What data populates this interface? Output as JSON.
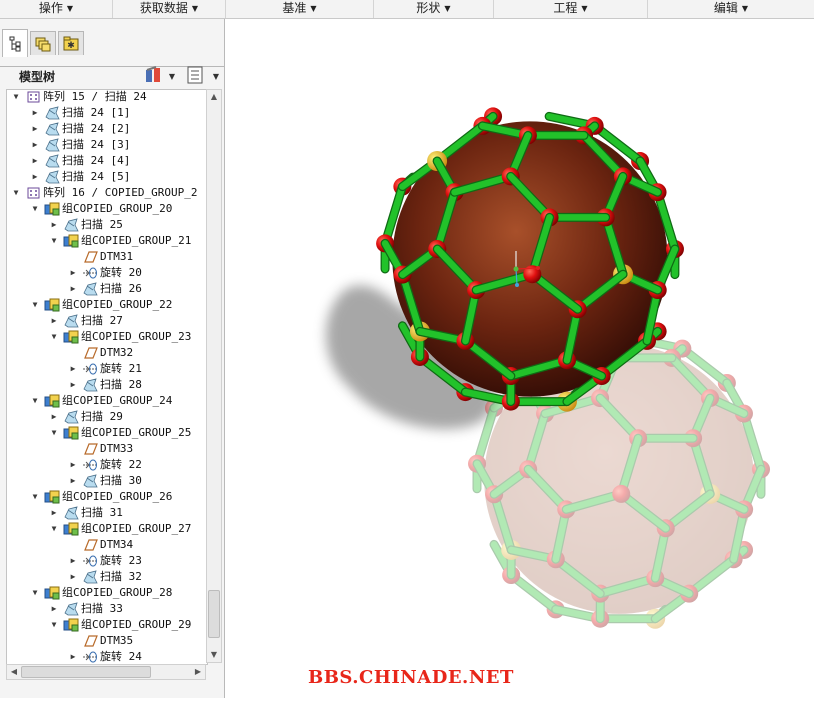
{
  "menu": [
    {
      "label": "操作"
    },
    {
      "label": "获取数据"
    },
    {
      "label": "基准"
    },
    {
      "label": "形状"
    },
    {
      "label": "工程"
    },
    {
      "label": "编辑"
    }
  ],
  "panel": {
    "tabs": [
      "model-tree-tab-icon",
      "layer-tab-icon",
      "favorites-tab-icon"
    ],
    "tree_title": "模型树",
    "settings_icon": "tree-settings-icon",
    "columns_icon": "tree-columns-icon"
  },
  "tree": [
    {
      "level": 0,
      "exp": "open",
      "icon": "pattern",
      "label": "阵列 15 / 扫描 24"
    },
    {
      "level": 1,
      "exp": "closed",
      "icon": "sweep",
      "label": "扫描 24 [1]"
    },
    {
      "level": 1,
      "exp": "closed",
      "icon": "sweep",
      "label": "扫描 24 [2]"
    },
    {
      "level": 1,
      "exp": "closed",
      "icon": "sweep",
      "label": "扫描 24 [3]"
    },
    {
      "level": 1,
      "exp": "closed",
      "icon": "sweep",
      "label": "扫描 24 [4]"
    },
    {
      "level": 1,
      "exp": "closed",
      "icon": "sweep",
      "label": "扫描 24 [5]"
    },
    {
      "level": 0,
      "exp": "open",
      "icon": "pattern",
      "label": "阵列 16 / COPIED_GROUP_2"
    },
    {
      "level": 1,
      "exp": "open",
      "icon": "group",
      "label": "组COPIED_GROUP_20"
    },
    {
      "level": 2,
      "exp": "closed",
      "icon": "sweep",
      "label": "扫描 25"
    },
    {
      "level": 2,
      "exp": "open",
      "icon": "group",
      "label": "组COPIED_GROUP_21"
    },
    {
      "level": 3,
      "exp": "none",
      "icon": "datum",
      "label": "DTM31"
    },
    {
      "level": 3,
      "exp": "closed",
      "icon": "revolve",
      "label": "旋转 20"
    },
    {
      "level": 3,
      "exp": "closed",
      "icon": "sweep",
      "label": "扫描 26"
    },
    {
      "level": 1,
      "exp": "open",
      "icon": "group",
      "label": "组COPIED_GROUP_22"
    },
    {
      "level": 2,
      "exp": "closed",
      "icon": "sweep",
      "label": "扫描 27"
    },
    {
      "level": 2,
      "exp": "open",
      "icon": "group",
      "label": "组COPIED_GROUP_23"
    },
    {
      "level": 3,
      "exp": "none",
      "icon": "datum",
      "label": "DTM32"
    },
    {
      "level": 3,
      "exp": "closed",
      "icon": "revolve",
      "label": "旋转 21"
    },
    {
      "level": 3,
      "exp": "closed",
      "icon": "sweep",
      "label": "扫描 28"
    },
    {
      "level": 1,
      "exp": "open",
      "icon": "group",
      "label": "组COPIED_GROUP_24"
    },
    {
      "level": 2,
      "exp": "closed",
      "icon": "sweep",
      "label": "扫描 29"
    },
    {
      "level": 2,
      "exp": "open",
      "icon": "group",
      "label": "组COPIED_GROUP_25"
    },
    {
      "level": 3,
      "exp": "none",
      "icon": "datum",
      "label": "DTM33"
    },
    {
      "level": 3,
      "exp": "closed",
      "icon": "revolve",
      "label": "旋转 22"
    },
    {
      "level": 3,
      "exp": "closed",
      "icon": "sweep",
      "label": "扫描 30"
    },
    {
      "level": 1,
      "exp": "open",
      "icon": "group",
      "label": "组COPIED_GROUP_26"
    },
    {
      "level": 2,
      "exp": "closed",
      "icon": "sweep",
      "label": "扫描 31"
    },
    {
      "level": 2,
      "exp": "open",
      "icon": "group",
      "label": "组COPIED_GROUP_27"
    },
    {
      "level": 3,
      "exp": "none",
      "icon": "datum",
      "label": "DTM34"
    },
    {
      "level": 3,
      "exp": "closed",
      "icon": "revolve",
      "label": "旋转 23"
    },
    {
      "level": 3,
      "exp": "closed",
      "icon": "sweep",
      "label": "扫描 32"
    },
    {
      "level": 1,
      "exp": "open",
      "icon": "group",
      "label": "组COPIED_GROUP_28"
    },
    {
      "level": 2,
      "exp": "closed",
      "icon": "sweep",
      "label": "扫描 33"
    },
    {
      "level": 2,
      "exp": "open",
      "icon": "group",
      "label": "组COPIED_GROUP_29"
    },
    {
      "level": 3,
      "exp": "none",
      "icon": "datum",
      "label": "DTM35"
    },
    {
      "level": 3,
      "exp": "closed",
      "icon": "revolve",
      "label": "旋转 24"
    }
  ],
  "viewport": {
    "model_name": "fullerene-ball-model",
    "colors": {
      "tube": "#22c22a",
      "node": "#e01010",
      "core": "#6b2410",
      "shadow": "#8a8a8a"
    }
  },
  "watermark": "BBS.CHINADE.NET"
}
